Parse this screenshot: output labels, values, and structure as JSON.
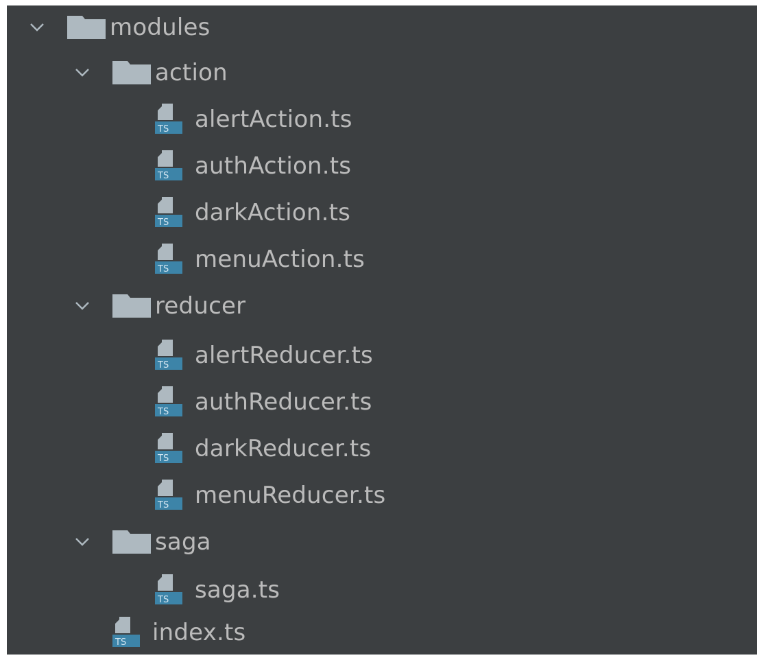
{
  "tree": {
    "items": [
      {
        "label": "modules",
        "kind": "folder",
        "depth": 0
      },
      {
        "label": "action",
        "kind": "folder",
        "depth": 1
      },
      {
        "label": "alertAction.ts",
        "kind": "ts",
        "depth": 2
      },
      {
        "label": "authAction.ts",
        "kind": "ts",
        "depth": 2
      },
      {
        "label": "darkAction.ts",
        "kind": "ts",
        "depth": 2
      },
      {
        "label": "menuAction.ts",
        "kind": "ts",
        "depth": 2
      },
      {
        "label": "reducer",
        "kind": "folder",
        "depth": 1
      },
      {
        "label": "alertReducer.ts",
        "kind": "ts",
        "depth": 2
      },
      {
        "label": "authReducer.ts",
        "kind": "ts",
        "depth": 2
      },
      {
        "label": "darkReducer.ts",
        "kind": "ts",
        "depth": 2
      },
      {
        "label": "menuReducer.ts",
        "kind": "ts",
        "depth": 2
      },
      {
        "label": "saga",
        "kind": "folder",
        "depth": 1
      },
      {
        "label": "saga.ts",
        "kind": "ts",
        "depth": 2
      },
      {
        "label": "index.ts",
        "kind": "ts",
        "depth": 1
      }
    ]
  },
  "icons": {
    "chevron": "chevron-down-icon",
    "folder": "folder-icon",
    "ts": "typescript-file-icon"
  },
  "colors": {
    "background": "#3c3f41",
    "text": "#bbbbbb",
    "folder": "#aeb9c0",
    "ts_badge": "#3d84a8"
  }
}
